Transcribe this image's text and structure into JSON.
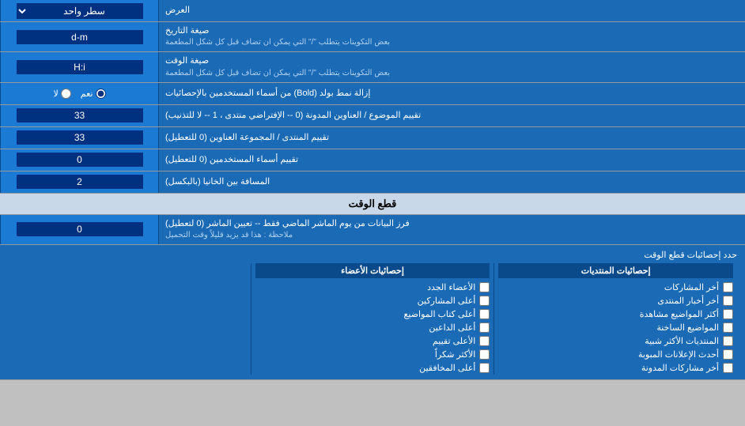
{
  "header": {
    "title": "العرض"
  },
  "rows": [
    {
      "id": "row-display-mode",
      "label": "العرض",
      "control_type": "select",
      "value": "سطر واحد"
    },
    {
      "id": "row-date-format",
      "label": "صيغة التاريخ",
      "sublabel": "بعض التكوينات يتطلب \"/\" التي يمكن ان تضاف قبل كل شكل المطعمة",
      "control_type": "input",
      "value": "d-m"
    },
    {
      "id": "row-time-format",
      "label": "صيغة الوقت",
      "sublabel": "بعض التكوينات يتطلب \"/\" التي يمكن ان تضاف قبل كل شكل المطعمة",
      "control_type": "input",
      "value": "H:i"
    },
    {
      "id": "row-bold",
      "label": "إزالة نمط بولد (Bold) من أسماء المستخدمين بالإحصائيات",
      "control_type": "radio",
      "options": [
        "نعم",
        "لا"
      ],
      "selected": "نعم"
    },
    {
      "id": "row-topics-sort",
      "label": "تقييم الموضوع / العناوين المدونة (0 -- الإفتراضي منتدى ، 1 -- لا للتذنيب)",
      "control_type": "input",
      "value": "33"
    },
    {
      "id": "row-forum-sort",
      "label": "تقييم المنتدى / المجموعة العناوين (0 للتعطيل)",
      "control_type": "input",
      "value": "33"
    },
    {
      "id": "row-users-sort",
      "label": "تقييم أسماء المستخدمين (0 للتعطيل)",
      "control_type": "input",
      "value": "0"
    },
    {
      "id": "row-spacing",
      "label": "المسافة بين الخانيا (بالبكسل)",
      "control_type": "input",
      "value": "2"
    }
  ],
  "section_cutoff": {
    "title": "قطع الوقت",
    "row": {
      "label": "فرز البيانات من يوم الماشر الماضي فقط -- تعيين الماشر (0 لتعطيل)",
      "sublabel": "ملاحظة : هذا قد يزيد قليلاً وقت التحميل",
      "value": "0"
    }
  },
  "stats_section": {
    "label": "حدد إحصائيات قطع الوقت",
    "columns": [
      {
        "id": "col-posts",
        "header": "إحصائيات المنتديات",
        "items": [
          "أخر المشاركات",
          "أخر أخبار المنتدى",
          "أكثر المواضيع مشاهدة",
          "المواضيع الساخنة",
          "المنتديات الأكثر شبية",
          "أحدث الإعلانات المبوبة",
          "أخر مشاركات المدونة"
        ]
      },
      {
        "id": "col-members",
        "header": "إحصائيات الأعضاء",
        "items": [
          "الأعضاء الجدد",
          "أعلى المشاركين",
          "أعلى كتاب المواضيع",
          "أعلى الداعين",
          "الأعلى تقييم",
          "الأكثر شكراً",
          "أعلى المخافقين"
        ]
      }
    ]
  }
}
